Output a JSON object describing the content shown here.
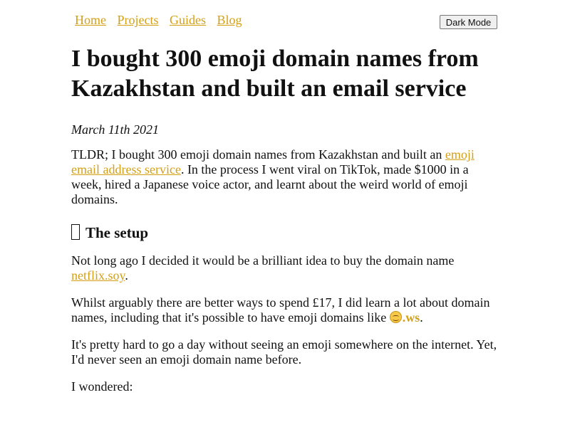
{
  "nav": {
    "items": [
      {
        "label": "Home"
      },
      {
        "label": "Projects"
      },
      {
        "label": "Guides"
      },
      {
        "label": "Blog"
      }
    ],
    "dark_mode_label": "Dark Mode"
  },
  "article": {
    "title": "I bought 300 emoji domain names from Kazakhstan and built an email service",
    "date": "March 11th 2021",
    "tldr": {
      "before": "TLDR; I bought 300 emoji domain names from Kazakhstan and built an ",
      "link": "emoji email address service",
      "after": ". In the process I went viral on TikTok, made $1000 in a week, hired a Japanese voice actor, and learnt about the weird world of emoji domains."
    },
    "section_heading": "The setup",
    "section_icon": "missing-glyph-box-icon",
    "p1": {
      "before": "Not long ago I decided it would be a brilliant idea to buy the domain name ",
      "link": "netflix.soy",
      "after": "."
    },
    "p2": {
      "before": "Whilst arguably there are better ways to spend £17, I did learn a lot about domain names, including that it's possible to have emoji domains like ",
      "emoji_icon": "smiling-face-icon",
      "link_suffix": ".ws",
      "after": "."
    },
    "p3": "It's pretty hard to go a day without seeing an emoji somewhere on the internet. Yet, I'd never seen an emoji domain name before.",
    "p4": "I wondered:"
  },
  "colors": {
    "link": "#d4a017",
    "text": "#111111",
    "background": "#ffffff"
  }
}
